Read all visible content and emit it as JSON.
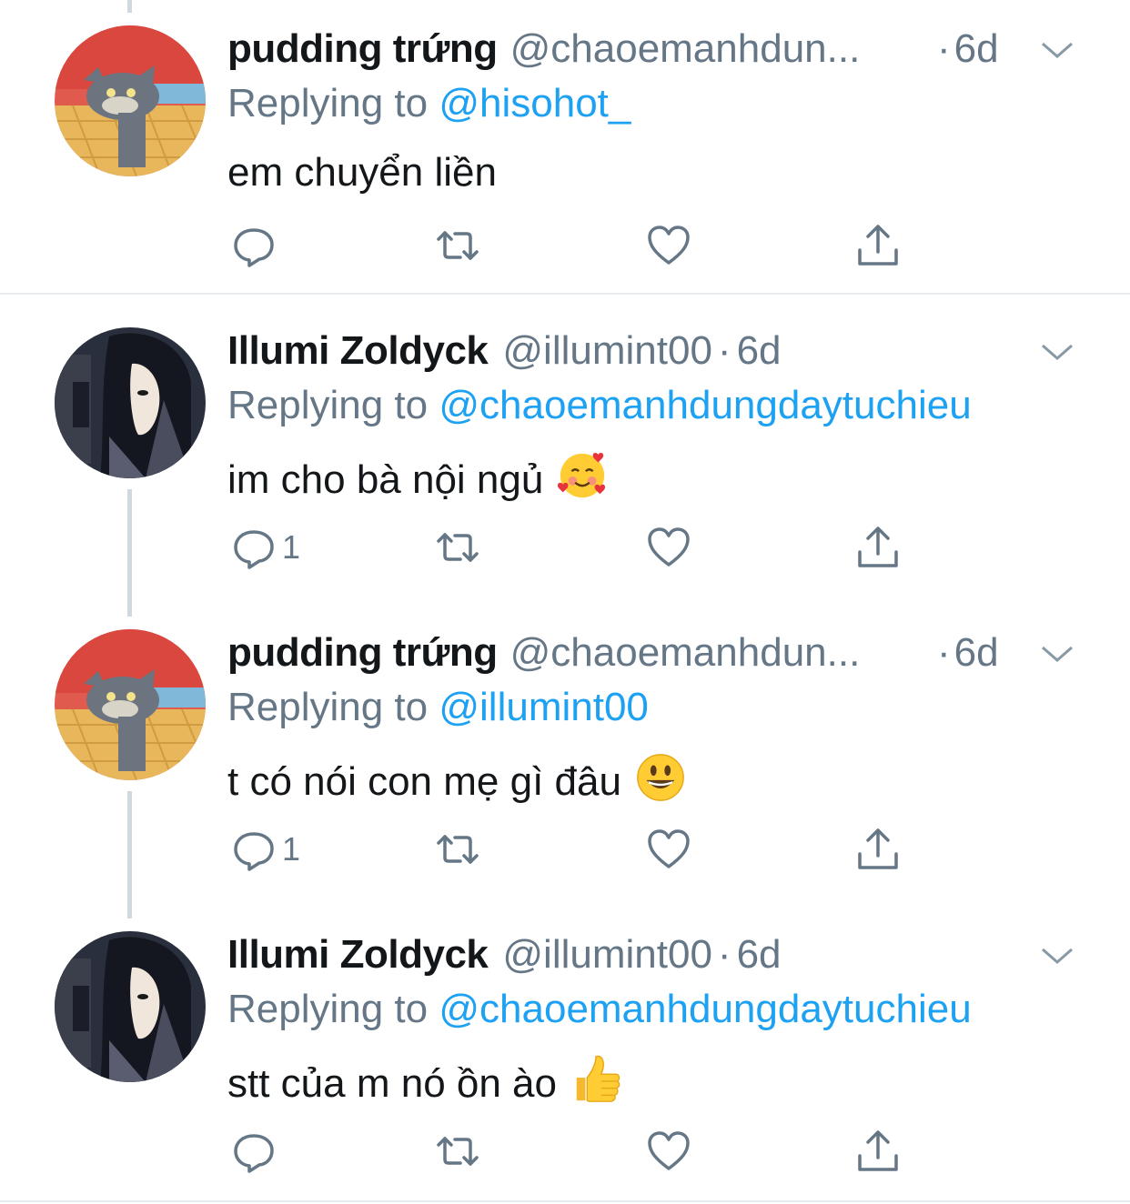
{
  "tweets": [
    {
      "name": "pudding trứng",
      "handle": "@chaoemanhdun...",
      "dot": "·",
      "time": "6d",
      "replying_prefix": "Replying to ",
      "replying_to": "@hisohot_",
      "text": "em chuyển liền",
      "emoji": "",
      "reply_count": "",
      "avatar": "tom-cat-avatar"
    },
    {
      "name": "Illumi Zoldyck",
      "handle": "@illumint00",
      "dot": "·",
      "time": "6d",
      "replying_prefix": "Replying to ",
      "replying_to": "@chaoemanhdungdaytuchieu",
      "text": "im cho bà nội ngủ",
      "emoji": "smiling-face-with-hearts",
      "reply_count": "1",
      "avatar": "anime-character-avatar"
    },
    {
      "name": "pudding trứng",
      "handle": "@chaoemanhdun...",
      "dot": "·",
      "time": "6d",
      "replying_prefix": "Replying to ",
      "replying_to": "@illumint00",
      "text": "t có nói con mẹ gì đâu",
      "emoji": "grinning-face",
      "reply_count": "1",
      "avatar": "tom-cat-avatar"
    },
    {
      "name": "Illumi Zoldyck",
      "handle": "@illumint00",
      "dot": "·",
      "time": "6d",
      "replying_prefix": "Replying to ",
      "replying_to": "@chaoemanhdungdaytuchieu",
      "text": "stt của m nó ồn ào",
      "emoji": "thumbs-up",
      "reply_count": "",
      "avatar": "anime-character-avatar"
    }
  ],
  "colors": {
    "text": "#14171a",
    "secondary": "#657786",
    "link": "#1da1f2",
    "thread_line": "#cfd9e0",
    "divider": "#e6ecf0"
  },
  "icons": [
    "reply-icon",
    "retweet-icon",
    "like-icon",
    "share-icon",
    "caret-down-icon"
  ]
}
